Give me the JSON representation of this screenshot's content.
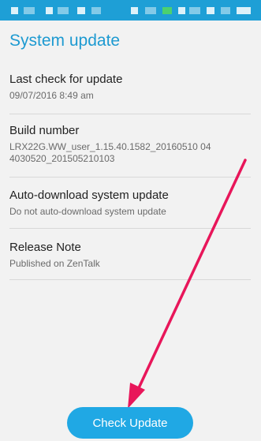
{
  "header": {
    "title": "System update"
  },
  "sections": [
    {
      "title": "Last check for update",
      "subtitle": "09/07/2016 8:49 am"
    },
    {
      "title": "Build number",
      "subtitle": "LRX22G.WW_user_1.15.40.1582_20160510 044030520_201505210103"
    },
    {
      "title": "Auto-download system update",
      "subtitle": "Do not auto-download system update"
    },
    {
      "title": "Release Note",
      "subtitle": "Published on ZenTalk"
    }
  ],
  "footer": {
    "check_update_label": "Check Update"
  },
  "colors": {
    "accent": "#1d9ad1",
    "button": "#20a8e4",
    "arrow": "#e8165a"
  },
  "icons": {
    "annotation": "arrow-annotation-icon"
  }
}
